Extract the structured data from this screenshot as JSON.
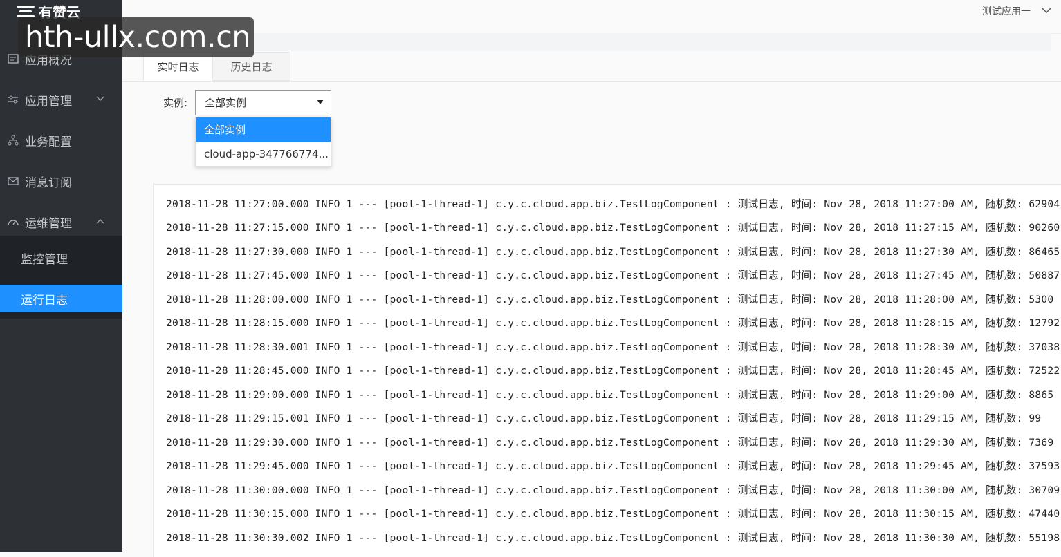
{
  "brand": {
    "name": "有赞云"
  },
  "watermark": "hth-ullx.com.cn",
  "header": {
    "app_switcher_label": "测试应用一"
  },
  "sidebar": {
    "items": [
      {
        "label": "应用概况",
        "icon": "dashboard-icon"
      },
      {
        "label": "应用管理",
        "icon": "sliders-icon",
        "expanded": false
      },
      {
        "label": "业务配置",
        "icon": "org-chart-icon"
      },
      {
        "label": "消息订阅",
        "icon": "envelope-icon"
      },
      {
        "label": "运维管理",
        "icon": "gauge-icon",
        "expanded": true
      }
    ],
    "subitems": [
      {
        "label": "监控管理",
        "active": false
      },
      {
        "label": "运行日志",
        "active": true
      }
    ]
  },
  "tabs": [
    {
      "label": "实时日志",
      "active": true
    },
    {
      "label": "历史日志",
      "active": false
    }
  ],
  "instance": {
    "label": "实例:",
    "selected": "全部实例",
    "options": [
      "全部实例",
      "cloud-app-347766774..."
    ]
  },
  "logs": [
    "2018-11-28 11:27:00.000 INFO 1 --- [pool-1-thread-1] c.y.c.cloud.app.biz.TestLogComponent : 测试日志, 时间: Nov 28, 2018 11:27:00 AM, 随机数: 62904",
    "2018-11-28 11:27:15.000 INFO 1 --- [pool-1-thread-1] c.y.c.cloud.app.biz.TestLogComponent : 测试日志, 时间: Nov 28, 2018 11:27:15 AM, 随机数: 90260",
    "2018-11-28 11:27:30.000 INFO 1 --- [pool-1-thread-1] c.y.c.cloud.app.biz.TestLogComponent : 测试日志, 时间: Nov 28, 2018 11:27:30 AM, 随机数: 86465",
    "2018-11-28 11:27:45.000 INFO 1 --- [pool-1-thread-1] c.y.c.cloud.app.biz.TestLogComponent : 测试日志, 时间: Nov 28, 2018 11:27:45 AM, 随机数: 50887",
    "2018-11-28 11:28:00.000 INFO 1 --- [pool-1-thread-1] c.y.c.cloud.app.biz.TestLogComponent : 测试日志, 时间: Nov 28, 2018 11:28:00 AM, 随机数: 5300",
    "2018-11-28 11:28:15.000 INFO 1 --- [pool-1-thread-1] c.y.c.cloud.app.biz.TestLogComponent : 测试日志, 时间: Nov 28, 2018 11:28:15 AM, 随机数: 12792",
    "2018-11-28 11:28:30.001 INFO 1 --- [pool-1-thread-1] c.y.c.cloud.app.biz.TestLogComponent : 测试日志, 时间: Nov 28, 2018 11:28:30 AM, 随机数: 37038",
    "2018-11-28 11:28:45.000 INFO 1 --- [pool-1-thread-1] c.y.c.cloud.app.biz.TestLogComponent : 测试日志, 时间: Nov 28, 2018 11:28:45 AM, 随机数: 72522",
    "2018-11-28 11:29:00.000 INFO 1 --- [pool-1-thread-1] c.y.c.cloud.app.biz.TestLogComponent : 测试日志, 时间: Nov 28, 2018 11:29:00 AM, 随机数: 8865",
    "2018-11-28 11:29:15.001 INFO 1 --- [pool-1-thread-1] c.y.c.cloud.app.biz.TestLogComponent : 测试日志, 时间: Nov 28, 2018 11:29:15 AM, 随机数: 99",
    "2018-11-28 11:29:30.000 INFO 1 --- [pool-1-thread-1] c.y.c.cloud.app.biz.TestLogComponent : 测试日志, 时间: Nov 28, 2018 11:29:30 AM, 随机数: 7369",
    "2018-11-28 11:29:45.000 INFO 1 --- [pool-1-thread-1] c.y.c.cloud.app.biz.TestLogComponent : 测试日志, 时间: Nov 28, 2018 11:29:45 AM, 随机数: 37593",
    "2018-11-28 11:30:00.000 INFO 1 --- [pool-1-thread-1] c.y.c.cloud.app.biz.TestLogComponent : 测试日志, 时间: Nov 28, 2018 11:30:00 AM, 随机数: 30709",
    "2018-11-28 11:30:15.000 INFO 1 --- [pool-1-thread-1] c.y.c.cloud.app.biz.TestLogComponent : 测试日志, 时间: Nov 28, 2018 11:30:15 AM, 随机数: 47440",
    "2018-11-28 11:30:30.002 INFO 1 --- [pool-1-thread-1] c.y.c.cloud.app.biz.TestLogComponent : 测试日志, 时间: Nov 28, 2018 11:30:30 AM, 随机数: 55198"
  ]
}
